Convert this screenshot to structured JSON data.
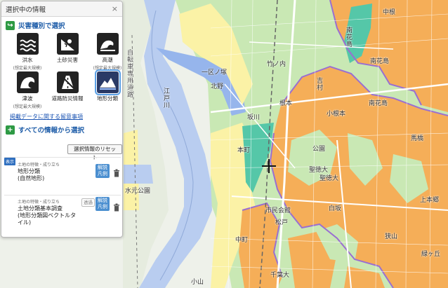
{
  "panel": {
    "title": "選択中の情報",
    "close": "×",
    "hazard_section_title": "災害種別で選択",
    "hazards": [
      {
        "name": "flood",
        "label": "洪水",
        "sub": "(想定最大規模)"
      },
      {
        "name": "landslide",
        "label": "土砂災害",
        "sub": ""
      },
      {
        "name": "storm-surge",
        "label": "高潮",
        "sub": "(想定最大規模)"
      },
      {
        "name": "tsunami",
        "label": "津波",
        "sub": "(想定最大規模)"
      },
      {
        "name": "road-disaster",
        "label": "道路防災情報",
        "sub": ""
      },
      {
        "name": "landform",
        "label": "地形分類",
        "sub": ""
      }
    ],
    "notice_link": "掲載データに関する留意事項",
    "all_info_title": "すべての情報から選択",
    "reset_button": "選択情報のリセット",
    "layers": [
      {
        "badge": "表示",
        "category": "土地の特徴・成り立ち",
        "name_line1": "地形分類",
        "name_line2": "(自然地形)",
        "legend_line1": "解説",
        "legend_line2": "凡例"
      },
      {
        "category": "土地の特徴・成り立ち",
        "name_line1": "土地分類基本調査",
        "name_line2": "(地形分類図ベクトルタ",
        "name_line3": "イル)",
        "transparency": "透過",
        "legend_line1": "解説",
        "legend_line2": "凡例"
      }
    ]
  },
  "map": {
    "labels": {
      "jitensha": "自転車専用道路",
      "edogawa": "江戸川",
      "ikkunotsuka": "一区ノ塚",
      "kitano": "北野",
      "takeyashi": "竹ノ内",
      "mizumoto": "水元公園",
      "minamihanashima": "南花島",
      "minamihanashima2": "南花島",
      "minamihanashima3": "南花島",
      "sakahimenocho": "坂川",
      "kogane": "小根本",
      "yoshiwara": "吉村",
      "nehomto": "根本",
      "hommachi": "本町",
      "yuhmon": "馬橋",
      "seitokudai": "聖徳大",
      "seitoku2": "聖徳大",
      "ichijomae": "市民会館",
      "matsudo": "松戸",
      "hakuba": "白坂",
      "koyama": "小山",
      "senjudai": "千葉大",
      "kitakoganemachi": "上本郷",
      "hora": "緑ヶ丘",
      "ameya": "中根",
      "park": "公園",
      "nakamachi": "中町",
      "sayamachi": "狭山"
    }
  },
  "colors": {
    "accent": "#1d5ca8",
    "green": "#2e9a44",
    "legend_btn": "#4b8fd0",
    "terrace_orange": "#f5ae58",
    "lowland_green": "#c9e8b4",
    "natural_levee_yellow": "#fbf2a6",
    "river_blue": "#b9cdf0",
    "valley_teal": "#55c7a8",
    "scarp_purple": "#9a6fd1"
  }
}
